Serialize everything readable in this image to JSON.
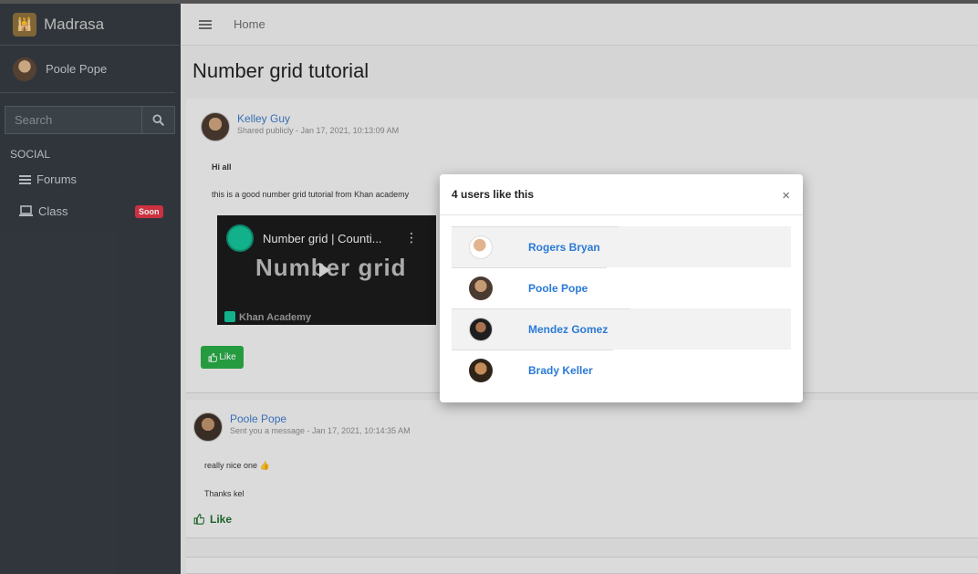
{
  "app": {
    "brand": "Madrasa"
  },
  "sidebar": {
    "user_name": "Poole Pope",
    "search_placeholder": "Search",
    "section_header": "SOCIAL",
    "items": [
      {
        "label": "Forums",
        "icon": "list-icon"
      },
      {
        "label": "Class",
        "icon": "laptop-icon",
        "badge": "Soon"
      }
    ]
  },
  "topbar": {
    "breadcrumb": "Home"
  },
  "page": {
    "title": "Number grid tutorial"
  },
  "post": {
    "author": "Kelley Guy",
    "meta": "Shared publicly - Jan 17, 2021, 10:13:09 AM",
    "greeting": "Hi all",
    "body": "this is a good number grid tutorial from Khan academy",
    "video": {
      "title": "Number grid | Counti...",
      "overlay_text": "Number grid",
      "channel": "Khan Academy"
    },
    "like_label": "Like"
  },
  "comment": {
    "author": "Poole Pope",
    "meta": "Sent you a message - Jan 17, 2021, 10:14:35 AM",
    "line1": "really nice one 👍",
    "line2": "Thanks kel",
    "like_label": "Like"
  },
  "modal": {
    "title": "4 users like this",
    "close": "×",
    "users": [
      {
        "name": "Rogers Bryan",
        "shaded": true
      },
      {
        "name": "Poole Pope",
        "shaded": false
      },
      {
        "name": "Mendez Gomez",
        "shaded": true
      },
      {
        "name": "Brady Keller",
        "shaded": false
      }
    ]
  },
  "colors": {
    "sidebar_bg": "#343a40",
    "link": "#2a7ad6",
    "like_green": "#28a745",
    "badge_red": "#dc3545"
  }
}
